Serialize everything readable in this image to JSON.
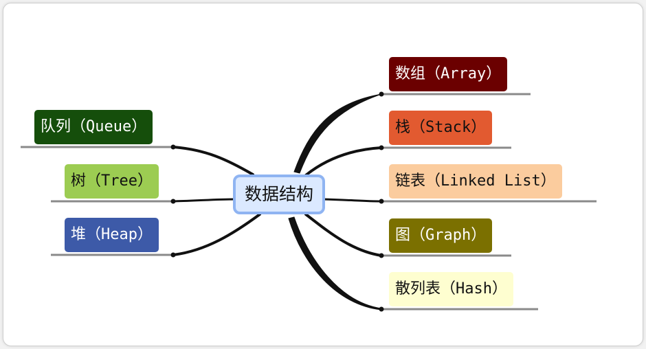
{
  "root": {
    "label": "数据结构",
    "fill": "#dbe9ff",
    "border": "#8fb4f2"
  },
  "branches": {
    "array": {
      "label": "数组（Array）",
      "bg": "#6b0000",
      "fg": "#ffffff"
    },
    "stack": {
      "label": "栈（Stack）",
      "bg": "#e25a30",
      "fg": "#111111"
    },
    "linked": {
      "label": "链表（Linked List）",
      "bg": "#fbcc9e",
      "fg": "#111111"
    },
    "graph": {
      "label": "图（Graph）",
      "bg": "#7b7000",
      "fg": "#ffffff"
    },
    "hash": {
      "label": "散列表（Hash）",
      "bg": "#fefed0",
      "fg": "#111111"
    },
    "queue": {
      "label": "队列（Queue）",
      "bg": "#154e0b",
      "fg": "#ffffff"
    },
    "tree": {
      "label": "树（Tree）",
      "bg": "#9ccc52",
      "fg": "#111111"
    },
    "heap": {
      "label": "堆（Heap）",
      "bg": "#3d5aa8",
      "fg": "#ffffff"
    }
  }
}
